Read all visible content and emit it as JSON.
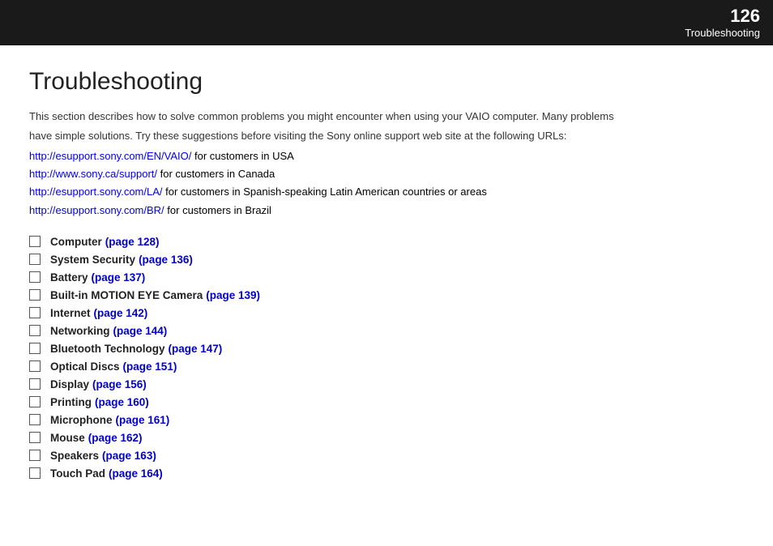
{
  "header": {
    "page_number": "126",
    "section": "Troubleshooting"
  },
  "page": {
    "title": "Troubleshooting",
    "intro_line1": "This section describes how to solve common problems you might encounter when using your VAIO computer. Many problems",
    "intro_line2": "have simple solutions. Try these suggestions before visiting the Sony online support web site at the following URLs:",
    "links": [
      {
        "url": "http://esupport.sony.com/EN/VAIO/",
        "label": "http://esupport.sony.com/EN/VAIO/",
        "suffix": " for customers in USA"
      },
      {
        "url": "http://www.sony.ca/support/",
        "label": "http://www.sony.ca/support/",
        "suffix": " for customers in Canada"
      },
      {
        "url": "http://esupport.sony.com/LA/",
        "label": "http://esupport.sony.com/LA/",
        "suffix": " for customers in Spanish-speaking Latin American countries or areas"
      },
      {
        "url": "http://esupport.sony.com/BR/",
        "label": "http://esupport.sony.com/BR/",
        "suffix": " for customers in Brazil"
      }
    ],
    "toc_items": [
      {
        "label": "Computer",
        "page_ref": "(page 128)"
      },
      {
        "label": "System Security",
        "page_ref": "(page 136)"
      },
      {
        "label": "Battery",
        "page_ref": "(page 137)"
      },
      {
        "label": "Built-in MOTION EYE Camera",
        "page_ref": "(page 139)"
      },
      {
        "label": "Internet",
        "page_ref": "(page 142)"
      },
      {
        "label": "Networking",
        "page_ref": "(page 144)"
      },
      {
        "label": "Bluetooth Technology",
        "page_ref": "(page 147)"
      },
      {
        "label": "Optical Discs",
        "page_ref": "(page 151)"
      },
      {
        "label": "Display",
        "page_ref": "(page 156)"
      },
      {
        "label": "Printing",
        "page_ref": "(page 160)"
      },
      {
        "label": "Microphone",
        "page_ref": "(page 161)"
      },
      {
        "label": "Mouse",
        "page_ref": "(page 162)"
      },
      {
        "label": "Speakers",
        "page_ref": "(page 163)"
      },
      {
        "label": "Touch Pad",
        "page_ref": "(page 164)"
      }
    ]
  }
}
